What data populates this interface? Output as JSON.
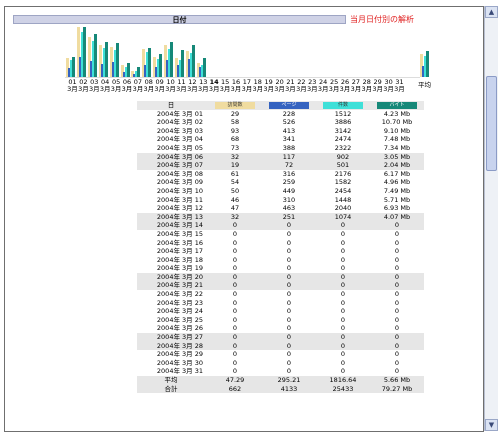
{
  "header": {
    "title": "日付"
  },
  "page_title": "当月日付別の解析",
  "colors": {
    "visits": "#f0dca0",
    "pages": "#3563c0",
    "hits": "#3fe0d8",
    "bytes": "#168878"
  },
  "columns": {
    "date": "日",
    "visits": "訪問数",
    "pages": "ページ",
    "hits": "件数",
    "bytes": "バイト"
  },
  "chart_data": {
    "type": "bar",
    "categories": [
      "01",
      "02",
      "03",
      "04",
      "05",
      "06",
      "07",
      "08",
      "09",
      "10",
      "11",
      "12",
      "13",
      "14",
      "15",
      "16",
      "17",
      "18",
      "19",
      "20",
      "21",
      "22",
      "23",
      "24",
      "25",
      "26",
      "27",
      "28",
      "29",
      "30",
      "31"
    ],
    "month_label": "3月",
    "today_index": 13,
    "series": [
      {
        "name": "訪問数",
        "values": [
          29,
          58,
          93,
          68,
          73,
          32,
          19,
          61,
          54,
          50,
          46,
          47,
          32,
          0,
          0,
          0,
          0,
          0,
          0,
          0,
          0,
          0,
          0,
          0,
          0,
          0,
          0,
          0,
          0,
          0,
          0
        ]
      },
      {
        "name": "ページ",
        "values": [
          228,
          526,
          413,
          341,
          388,
          117,
          72,
          316,
          259,
          449,
          310,
          463,
          251,
          0,
          0,
          0,
          0,
          0,
          0,
          0,
          0,
          0,
          0,
          0,
          0,
          0,
          0,
          0,
          0,
          0,
          0
        ]
      },
      {
        "name": "件数",
        "values": [
          1512,
          3886,
          3142,
          2474,
          2322,
          902,
          501,
          2176,
          1582,
          2454,
          1448,
          2040,
          1074,
          0,
          0,
          0,
          0,
          0,
          0,
          0,
          0,
          0,
          0,
          0,
          0,
          0,
          0,
          0,
          0,
          0,
          0
        ]
      },
      {
        "name": "バイト",
        "values": [
          4.23,
          10.7,
          9.1,
          7.48,
          7.34,
          3.05,
          2.04,
          6.17,
          4.96,
          7.49,
          5.71,
          6.93,
          4.07,
          0,
          0,
          0,
          0,
          0,
          0,
          0,
          0,
          0,
          0,
          0,
          0,
          0,
          0,
          0,
          0,
          0,
          0
        ]
      }
    ],
    "average_label": "平均",
    "averages": [
      47.29,
      295.21,
      1816.64,
      5.66
    ]
  },
  "rows": [
    {
      "date": "2004年 3月 01",
      "visits": "29",
      "pages": "228",
      "hits": "1512",
      "bytes": "4.23 Mb"
    },
    {
      "date": "2004年 3月 02",
      "visits": "58",
      "pages": "526",
      "hits": "3886",
      "bytes": "10.70 Mb"
    },
    {
      "date": "2004年 3月 03",
      "visits": "93",
      "pages": "413",
      "hits": "3142",
      "bytes": "9.10 Mb"
    },
    {
      "date": "2004年 3月 04",
      "visits": "68",
      "pages": "341",
      "hits": "2474",
      "bytes": "7.48 Mb"
    },
    {
      "date": "2004年 3月 05",
      "visits": "73",
      "pages": "388",
      "hits": "2322",
      "bytes": "7.34 Mb"
    },
    {
      "date": "2004年 3月 06",
      "visits": "32",
      "pages": "117",
      "hits": "902",
      "bytes": "3.05 Mb"
    },
    {
      "date": "2004年 3月 07",
      "visits": "19",
      "pages": "72",
      "hits": "501",
      "bytes": "2.04 Mb"
    },
    {
      "date": "2004年 3月 08",
      "visits": "61",
      "pages": "316",
      "hits": "2176",
      "bytes": "6.17 Mb"
    },
    {
      "date": "2004年 3月 09",
      "visits": "54",
      "pages": "259",
      "hits": "1582",
      "bytes": "4.96 Mb"
    },
    {
      "date": "2004年 3月 10",
      "visits": "50",
      "pages": "449",
      "hits": "2454",
      "bytes": "7.49 Mb"
    },
    {
      "date": "2004年 3月 11",
      "visits": "46",
      "pages": "310",
      "hits": "1448",
      "bytes": "5.71 Mb"
    },
    {
      "date": "2004年 3月 12",
      "visits": "47",
      "pages": "463",
      "hits": "2040",
      "bytes": "6.93 Mb"
    },
    {
      "date": "2004年 3月 13",
      "visits": "32",
      "pages": "251",
      "hits": "1074",
      "bytes": "4.07 Mb"
    },
    {
      "date": "2004年 3月 14",
      "visits": "0",
      "pages": "0",
      "hits": "0",
      "bytes": "0"
    },
    {
      "date": "2004年 3月 15",
      "visits": "0",
      "pages": "0",
      "hits": "0",
      "bytes": "0"
    },
    {
      "date": "2004年 3月 16",
      "visits": "0",
      "pages": "0",
      "hits": "0",
      "bytes": "0"
    },
    {
      "date": "2004年 3月 17",
      "visits": "0",
      "pages": "0",
      "hits": "0",
      "bytes": "0"
    },
    {
      "date": "2004年 3月 18",
      "visits": "0",
      "pages": "0",
      "hits": "0",
      "bytes": "0"
    },
    {
      "date": "2004年 3月 19",
      "visits": "0",
      "pages": "0",
      "hits": "0",
      "bytes": "0"
    },
    {
      "date": "2004年 3月 20",
      "visits": "0",
      "pages": "0",
      "hits": "0",
      "bytes": "0"
    },
    {
      "date": "2004年 3月 21",
      "visits": "0",
      "pages": "0",
      "hits": "0",
      "bytes": "0"
    },
    {
      "date": "2004年 3月 22",
      "visits": "0",
      "pages": "0",
      "hits": "0",
      "bytes": "0"
    },
    {
      "date": "2004年 3月 23",
      "visits": "0",
      "pages": "0",
      "hits": "0",
      "bytes": "0"
    },
    {
      "date": "2004年 3月 24",
      "visits": "0",
      "pages": "0",
      "hits": "0",
      "bytes": "0"
    },
    {
      "date": "2004年 3月 25",
      "visits": "0",
      "pages": "0",
      "hits": "0",
      "bytes": "0"
    },
    {
      "date": "2004年 3月 26",
      "visits": "0",
      "pages": "0",
      "hits": "0",
      "bytes": "0"
    },
    {
      "date": "2004年 3月 27",
      "visits": "0",
      "pages": "0",
      "hits": "0",
      "bytes": "0"
    },
    {
      "date": "2004年 3月 28",
      "visits": "0",
      "pages": "0",
      "hits": "0",
      "bytes": "0"
    },
    {
      "date": "2004年 3月 29",
      "visits": "0",
      "pages": "0",
      "hits": "0",
      "bytes": "0"
    },
    {
      "date": "2004年 3月 30",
      "visits": "0",
      "pages": "0",
      "hits": "0",
      "bytes": "0"
    },
    {
      "date": "2004年 3月 31",
      "visits": "0",
      "pages": "0",
      "hits": "0",
      "bytes": "0"
    }
  ],
  "alt_rows": [
    "2004年 3月 06",
    "2004年 3月 07",
    "2004年 3月 13",
    "2004年 3月 14",
    "2004年 3月 20",
    "2004年 3月 21",
    "2004年 3月 27",
    "2004年 3月 28"
  ],
  "footer": {
    "average": {
      "label": "平均",
      "visits": "47.29",
      "pages": "295.21",
      "hits": "1816.64",
      "bytes": "5.66 Mb"
    },
    "total": {
      "label": "合計",
      "visits": "662",
      "pages": "4133",
      "hits": "25433",
      "bytes": "79.27 Mb"
    }
  }
}
